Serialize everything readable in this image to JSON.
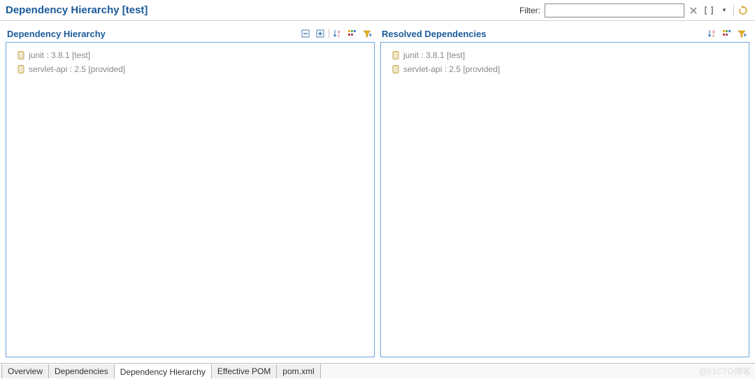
{
  "header": {
    "title": "Dependency Hierarchy [test]",
    "filter_label": "Filter:",
    "filter_value": ""
  },
  "panels": {
    "hierarchy": {
      "title": "Dependency Hierarchy",
      "items": [
        {
          "label": "junit : 3.8.1 [test]"
        },
        {
          "label": "servlet-api : 2.5 [provided]"
        }
      ]
    },
    "resolved": {
      "title": "Resolved Dependencies",
      "items": [
        {
          "label": "junit : 3.8.1 [test]"
        },
        {
          "label": "servlet-api : 2.5 [provided]"
        }
      ]
    }
  },
  "tabs": [
    {
      "label": "Overview",
      "active": false
    },
    {
      "label": "Dependencies",
      "active": false
    },
    {
      "label": "Dependency Hierarchy",
      "active": true
    },
    {
      "label": "Effective POM",
      "active": false
    },
    {
      "label": "pom.xml",
      "active": false
    }
  ],
  "watermark": "@51CTO博客"
}
